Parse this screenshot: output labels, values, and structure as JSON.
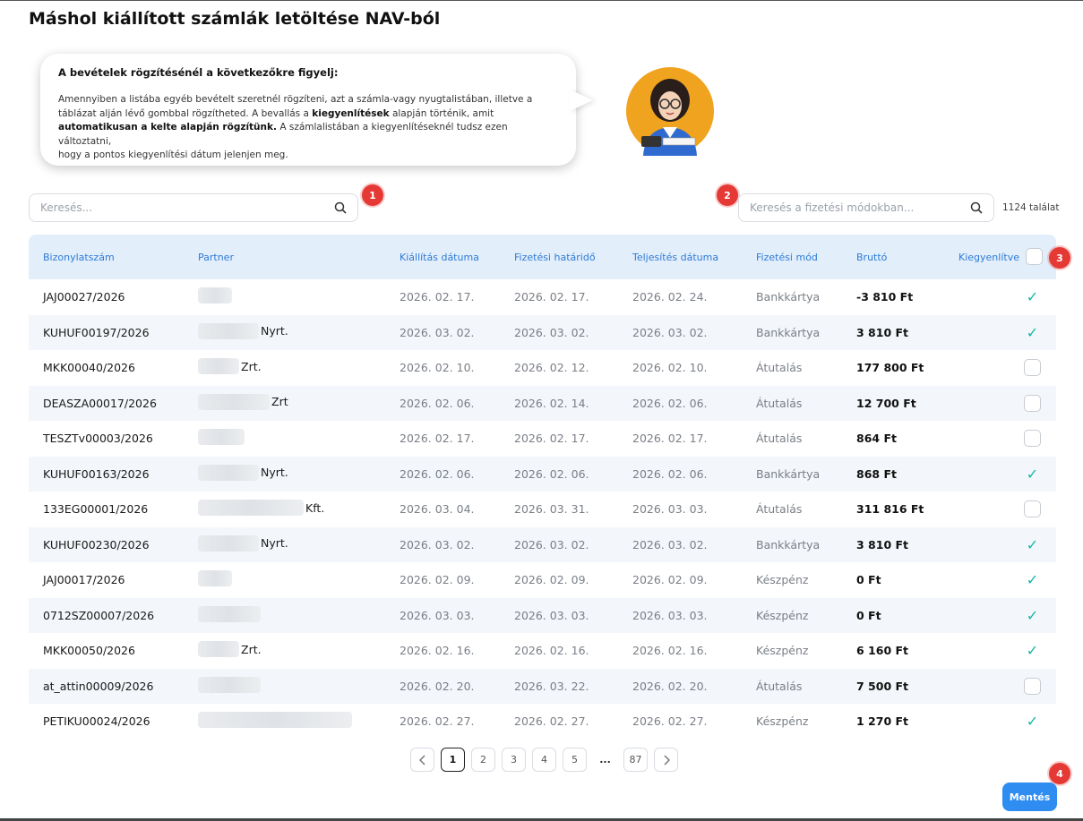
{
  "page_title": "Máshol kiállított számlák letöltése NAV-ból",
  "bubble": {
    "heading": "A bevételek rögzítésénél a következőkre figyelj:",
    "p1": "Amennyiben a listába egyéb bevételt szeretnél rögzíteni, azt a számla-vagy nyugtalistában, illetve a",
    "p2": "táblázat alján lévő gombbal rögzítheted. A bevallás a ",
    "p2_bold": "kiegyenlítések",
    "p2_end": " alapján történik, amit",
    "p3_bold": "automatikusan a kelte alapján rögzítünk.",
    "p3": " A számlalistában a kiegyenlítéseknél tudsz ezen változtatni,",
    "p4": "hogy a pontos kiegyenlítési dátum jelenjen meg."
  },
  "search": {
    "placeholder": "Keresés..."
  },
  "payment_search": {
    "placeholder": "Keresés a fizetési módokban..."
  },
  "result_count": "1124 találat",
  "markers": [
    "1",
    "2",
    "3",
    "4"
  ],
  "table": {
    "headers": {
      "number": "Bizonylatszám",
      "partner": "Partner",
      "issue_date": "Kiállítás dátuma",
      "due_date": "Fizetési határidő",
      "fulfil_date": "Teljesítés dátuma",
      "payment": "Fizetési mód",
      "gross": "Bruttó",
      "settled": "Kiegyenlítve"
    },
    "rows": [
      {
        "number": "JAJ00027/2026",
        "partner_suffix": "",
        "issue": "2026. 02. 17.",
        "due": "2026. 02. 17.",
        "fulfil": "2026. 02. 24.",
        "payment": "Bankkártya",
        "gross": "-3 810 Ft",
        "settled": true
      },
      {
        "number": "KUHUF00197/2026",
        "partner_suffix": "Nyrt.",
        "issue": "2026. 03. 02.",
        "due": "2026. 03. 02.",
        "fulfil": "2026. 03. 02.",
        "payment": "Bankkártya",
        "gross": "3 810 Ft",
        "settled": true
      },
      {
        "number": "MKK00040/2026",
        "partner_suffix": "Zrt.",
        "issue": "2026. 02. 10.",
        "due": "2026. 02. 12.",
        "fulfil": "2026. 02. 10.",
        "payment": "Átutalás",
        "gross": "177 800 Ft",
        "settled": false
      },
      {
        "number": "DEASZA00017/2026",
        "partner_suffix": "Zrt",
        "issue": "2026. 02. 06.",
        "due": "2026. 02. 14.",
        "fulfil": "2026. 02. 06.",
        "payment": "Átutalás",
        "gross": "12 700 Ft",
        "settled": false
      },
      {
        "number": "TESZTv00003/2026",
        "partner_suffix": "",
        "issue": "2026. 02. 17.",
        "due": "2026. 02. 17.",
        "fulfil": "2026. 02. 17.",
        "payment": "Átutalás",
        "gross": "864 Ft",
        "settled": false
      },
      {
        "number": "KUHUF00163/2026",
        "partner_suffix": "Nyrt.",
        "issue": "2026. 02. 06.",
        "due": "2026. 02. 06.",
        "fulfil": "2026. 02. 06.",
        "payment": "Bankkártya",
        "gross": "868 Ft",
        "settled": true
      },
      {
        "number": "133EG00001/2026",
        "partner_suffix": "Kft.",
        "issue": "2026. 03. 04.",
        "due": "2026. 03. 31.",
        "fulfil": "2026. 03. 03.",
        "payment": "Átutalás",
        "gross": "311 816 Ft",
        "settled": false
      },
      {
        "number": "KUHUF00230/2026",
        "partner_suffix": "Nyrt.",
        "issue": "2026. 03. 02.",
        "due": "2026. 03. 02.",
        "fulfil": "2026. 03. 02.",
        "payment": "Bankkártya",
        "gross": "3 810 Ft",
        "settled": true
      },
      {
        "number": "JAJ00017/2026",
        "partner_suffix": "",
        "issue": "2026. 02. 09.",
        "due": "2026. 02. 09.",
        "fulfil": "2026. 02. 09.",
        "payment": "Készpénz",
        "gross": "0 Ft",
        "settled": true
      },
      {
        "number": "0712SZ00007/2026",
        "partner_suffix": "",
        "issue": "2026. 03. 03.",
        "due": "2026. 03. 03.",
        "fulfil": "2026. 03. 03.",
        "payment": "Készpénz",
        "gross": "0 Ft",
        "settled": true
      },
      {
        "number": "MKK00050/2026",
        "partner_suffix": "Zrt.",
        "issue": "2026. 02. 16.",
        "due": "2026. 02. 16.",
        "fulfil": "2026. 02. 16.",
        "payment": "Készpénz",
        "gross": "6 160 Ft",
        "settled": true
      },
      {
        "number": "at_attin00009/2026",
        "partner_suffix": "",
        "issue": "2026. 02. 20.",
        "due": "2026. 03. 22.",
        "fulfil": "2026. 02. 20.",
        "payment": "Átutalás",
        "gross": "7 500 Ft",
        "settled": false
      },
      {
        "number": "PETIKU00024/2026",
        "partner_suffix": "",
        "issue": "2026. 02. 27.",
        "due": "2026. 02. 27.",
        "fulfil": "2026. 02. 27.",
        "payment": "Készpénz",
        "gross": "1 270 Ft",
        "settled": true
      }
    ]
  },
  "pagination": {
    "pages": [
      "1",
      "2",
      "3",
      "4",
      "5"
    ],
    "ellipsis": "...",
    "last": "87",
    "current": "1"
  },
  "save_label": "Mentés",
  "colors": {
    "accent": "#2f8cf0",
    "header_text": "#2d7bd6",
    "tick": "#14b8a6",
    "marker": "#e53935"
  }
}
